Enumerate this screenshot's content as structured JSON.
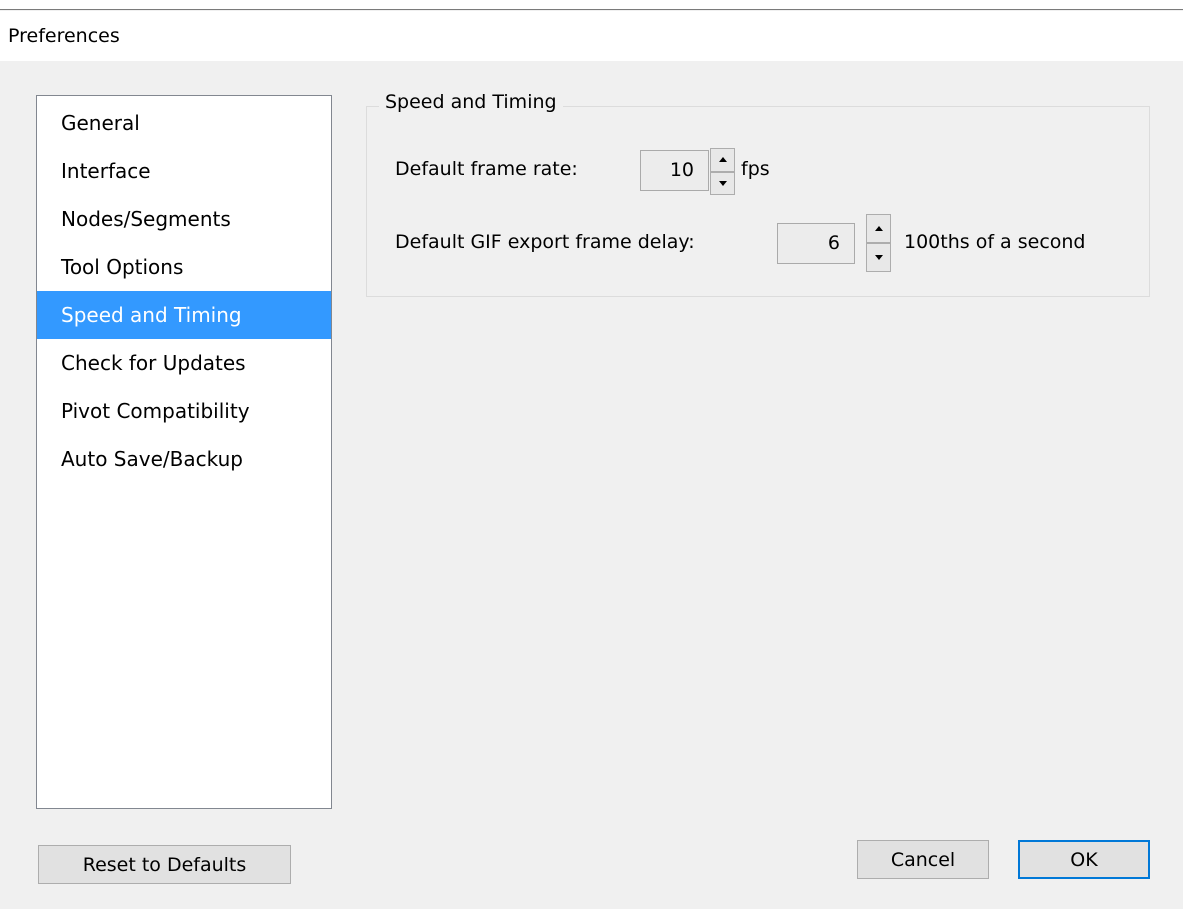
{
  "window": {
    "title": "Preferences"
  },
  "sidebar": {
    "selected_index": 4,
    "items": [
      {
        "label": "General"
      },
      {
        "label": "Interface"
      },
      {
        "label": "Nodes/Segments"
      },
      {
        "label": "Tool Options"
      },
      {
        "label": "Speed and Timing"
      },
      {
        "label": "Check for Updates"
      },
      {
        "label": "Pivot Compatibility"
      },
      {
        "label": "Auto Save/Backup"
      }
    ]
  },
  "panel": {
    "group_title": "Speed and Timing",
    "frame_rate": {
      "label": "Default frame rate:",
      "value": "10",
      "unit": "fps"
    },
    "gif_delay": {
      "label": "Default GIF export frame delay:",
      "value": "6",
      "unit": "100ths of a second"
    }
  },
  "footer": {
    "reset_label": "Reset to Defaults",
    "cancel_label": "Cancel",
    "ok_label": "OK"
  },
  "colors": {
    "selection": "#3399ff",
    "dialog_background": "#f0f0f0",
    "default_button_border": "#0078d7"
  },
  "icons": {
    "spin_up": "triangle-up-icon",
    "spin_down": "triangle-down-icon"
  }
}
